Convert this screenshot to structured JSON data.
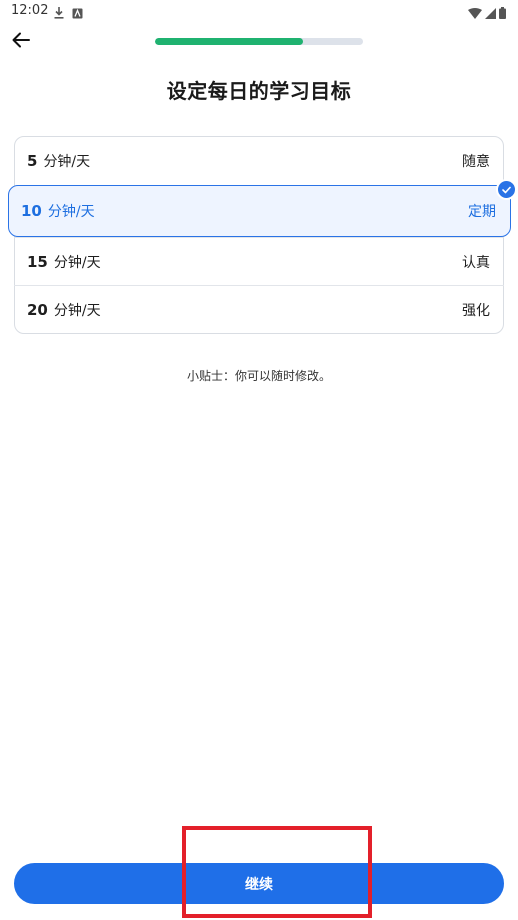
{
  "status_bar": {
    "time": "12:02",
    "left_icons": [
      "download-icon",
      "app-notification-icon"
    ],
    "right_icons": [
      "wifi-icon",
      "cell-signal-icon",
      "battery-icon"
    ]
  },
  "header": {
    "back_icon": "arrow-left-icon",
    "progress": 0.71,
    "progress_color": "#1fb270"
  },
  "title": "设定每日的学习目标",
  "options": [
    {
      "minutes": "5",
      "unit": "分钟/天",
      "tag": "随意",
      "selected": false
    },
    {
      "minutes": "10",
      "unit": "分钟/天",
      "tag": "定期",
      "selected": true
    },
    {
      "minutes": "15",
      "unit": "分钟/天",
      "tag": "认真",
      "selected": false
    },
    {
      "minutes": "20",
      "unit": "分钟/天",
      "tag": "强化",
      "selected": false
    }
  ],
  "tip": "小贴士：你可以随时修改。",
  "continue_label": "继续",
  "colors": {
    "accent": "#1f6fe8",
    "highlight": "#e3202a"
  }
}
